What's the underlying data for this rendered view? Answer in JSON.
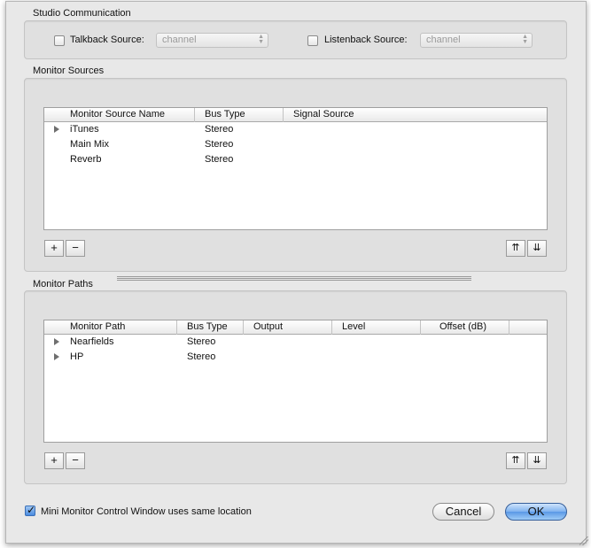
{
  "studio_communication": {
    "title": "Studio Communication",
    "talkback_label": "Talkback Source:",
    "talkback_value": "channel",
    "talkback_checked": false,
    "listenback_label": "Listenback Source:",
    "listenback_value": "channel",
    "listenback_checked": false
  },
  "monitor_sources": {
    "title": "Monitor Sources",
    "columns": [
      "Monitor Source Name",
      "Bus Type",
      "Signal Source"
    ],
    "rows": [
      {
        "name": "iTunes",
        "bus": "Stereo",
        "signal": "",
        "expandable": true
      },
      {
        "name": "Main Mix",
        "bus": "Stereo",
        "signal": "",
        "expandable": false
      },
      {
        "name": "Reverb",
        "bus": "Stereo",
        "signal": "",
        "expandable": false
      }
    ],
    "add_label": "+",
    "remove_label": "−",
    "move_up_label": "⇈",
    "move_down_label": "⇊"
  },
  "monitor_paths": {
    "title": "Monitor Paths",
    "columns": [
      "Monitor Path",
      "Bus Type",
      "Output",
      "Level",
      "Offset (dB)"
    ],
    "rows": [
      {
        "name": "Nearfields",
        "bus": "Stereo",
        "output": "",
        "level": "",
        "offset": "",
        "expandable": true
      },
      {
        "name": "HP",
        "bus": "Stereo",
        "output": "",
        "level": "",
        "offset": "",
        "expandable": true
      }
    ],
    "add_label": "+",
    "remove_label": "−",
    "move_up_label": "⇈",
    "move_down_label": "⇊"
  },
  "footer": {
    "mini_monitor_label": "Mini Monitor Control Window uses same location",
    "mini_monitor_checked": true,
    "cancel_label": "Cancel",
    "ok_label": "OK"
  }
}
